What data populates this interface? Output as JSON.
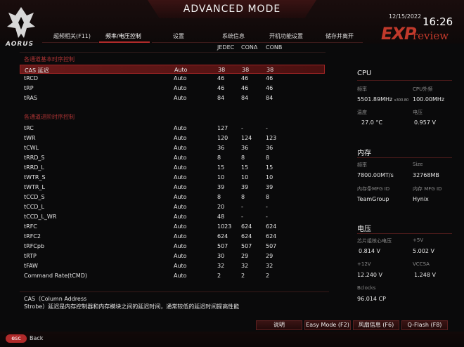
{
  "header": {
    "mode_title": "ADVANCED MODE",
    "brand": "AORUS",
    "date": "12/15/2022",
    "time": "16:26",
    "watermark_exp": "EXP",
    "watermark_review": "review"
  },
  "tabs": [
    {
      "label": "超频相关(F11)",
      "active": false
    },
    {
      "label": "频率/电压控制",
      "active": true
    },
    {
      "label": "设置",
      "active": false
    },
    {
      "label": "系统信息",
      "active": false
    },
    {
      "label": "开机功能设置",
      "active": false
    },
    {
      "label": "储存并离开",
      "active": false
    }
  ],
  "columns": {
    "jedec": "JEDEC",
    "cona": "CONA",
    "conb": "CONB"
  },
  "section1": {
    "title": "各通道基本时序控制",
    "rows": [
      {
        "name": "CAS 延迟",
        "mode": "Auto",
        "jedec": "38",
        "cona": "38",
        "conb": "38",
        "selected": true
      },
      {
        "name": "tRCD",
        "mode": "Auto",
        "jedec": "46",
        "cona": "46",
        "conb": "46"
      },
      {
        "name": "tRP",
        "mode": "Auto",
        "jedec": "46",
        "cona": "46",
        "conb": "46"
      },
      {
        "name": "tRAS",
        "mode": "Auto",
        "jedec": "84",
        "cona": "84",
        "conb": "84"
      }
    ]
  },
  "section2": {
    "title": "各通道进阶时序控制",
    "rows": [
      {
        "name": "tRC",
        "mode": "Auto",
        "jedec": "127",
        "cona": "-",
        "conb": "-"
      },
      {
        "name": "tWR",
        "mode": "Auto",
        "jedec": "120",
        "cona": "124",
        "conb": "123"
      },
      {
        "name": "tCWL",
        "mode": "Auto",
        "jedec": "36",
        "cona": "36",
        "conb": "36"
      },
      {
        "name": "tRRD_S",
        "mode": "Auto",
        "jedec": "8",
        "cona": "8",
        "conb": "8"
      },
      {
        "name": "tRRD_L",
        "mode": "Auto",
        "jedec": "15",
        "cona": "15",
        "conb": "15"
      },
      {
        "name": "tWTR_S",
        "mode": "Auto",
        "jedec": "10",
        "cona": "10",
        "conb": "10"
      },
      {
        "name": "tWTR_L",
        "mode": "Auto",
        "jedec": "39",
        "cona": "39",
        "conb": "39"
      },
      {
        "name": "tCCD_S",
        "mode": "Auto",
        "jedec": "8",
        "cona": "8",
        "conb": "8"
      },
      {
        "name": "tCCD_L",
        "mode": "Auto",
        "jedec": "20",
        "cona": "-",
        "conb": "-"
      },
      {
        "name": "tCCD_L_WR",
        "mode": "Auto",
        "jedec": "48",
        "cona": "-",
        "conb": "-"
      },
      {
        "name": "tRFC",
        "mode": "Auto",
        "jedec": "1023",
        "cona": "624",
        "conb": "624"
      },
      {
        "name": "tRFC2",
        "mode": "Auto",
        "jedec": "624",
        "cona": "624",
        "conb": "624"
      },
      {
        "name": "tRFCpb",
        "mode": "Auto",
        "jedec": "507",
        "cona": "507",
        "conb": "507"
      },
      {
        "name": "tRTP",
        "mode": "Auto",
        "jedec": "30",
        "cona": "29",
        "conb": "29"
      },
      {
        "name": "tFAW",
        "mode": "Auto",
        "jedec": "32",
        "cona": "32",
        "conb": "32"
      },
      {
        "name": "Command Rate(tCMD)",
        "mode": "Auto",
        "jedec": "2",
        "cona": "2",
        "conb": "2"
      }
    ]
  },
  "help": {
    "line1": "CAS（Column Address",
    "line2": "Strobe）延迟是内存控制器和内存模块之间的延迟时间，通常较低的延迟时间提高性能"
  },
  "right_panel": {
    "cpu": {
      "title": "CPU",
      "freq_label": "频率",
      "freq_value": "5501.89MHz",
      "freq_sub": "x300.80",
      "ext_label": "CPU外频",
      "ext_value": "100.00MHz",
      "temp_label": "温度",
      "temp_value": "27.0 °C",
      "volt_label": "电压",
      "volt_value": "0.957 V"
    },
    "memory": {
      "title": "内存",
      "freq_label": "频率",
      "freq_value": "7800.00MT/s",
      "size_label": "Size",
      "size_value": "32768MB",
      "mfg1_label": "内存条MFG ID",
      "mfg1_value": "TeamGroup",
      "mfg2_label": "内存 MFG ID",
      "mfg2_value": "Hynix"
    },
    "voltage": {
      "title": "电压",
      "chipset_label": "芯片组核心电压",
      "chipset_value": "0.814 V",
      "p5v_label": "+5V",
      "p5v_value": "5.002 V",
      "p12v_label": "+12V",
      "p12v_value": "12.240 V",
      "vccsa_label": "VCCSA",
      "vccsa_value": "1.248 V",
      "bclk_label": "Bclocks",
      "bclk_value": "96.014 CP"
    }
  },
  "footer": {
    "esc_label": "esc",
    "back_label": "Back",
    "help_btn": "说明",
    "easy_btn": "Easy Mode (F2)",
    "fan_btn": "风扇信息 (F6)",
    "qflash_btn": "Q-Flash (F8)"
  }
}
